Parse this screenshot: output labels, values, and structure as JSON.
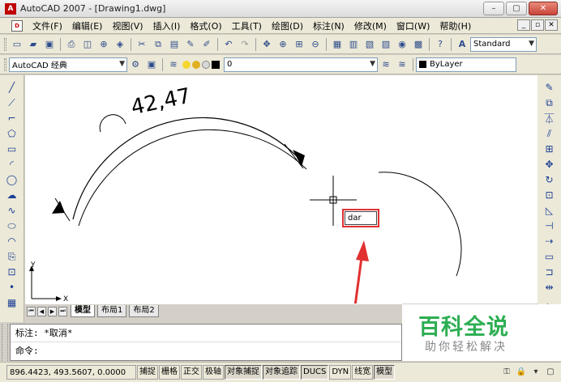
{
  "window": {
    "title": "AutoCAD 2007 - [Drawing1.dwg]",
    "min": "–",
    "max": "▢",
    "close": "✕"
  },
  "menu": [
    "文件(F)",
    "编辑(E)",
    "视图(V)",
    "插入(I)",
    "格式(O)",
    "工具(T)",
    "绘图(D)",
    "标注(N)",
    "修改(M)",
    "窗口(W)",
    "帮助(H)"
  ],
  "toolbar": {
    "text_style": "Standard",
    "workspace": "AutoCAD 经典",
    "layer": "0",
    "color": "ByLayer"
  },
  "canvas": {
    "dimension_text": "42,47",
    "dyn_input": "dar",
    "ucs_x": "X",
    "ucs_y": "Y"
  },
  "layout_tabs": [
    "模型",
    "布局1",
    "布局2"
  ],
  "command": {
    "history": "标注: *取消*",
    "prompt": "命令:"
  },
  "watermark": {
    "title": "百科全说",
    "subtitle": "助你轻松解决"
  },
  "status": {
    "coordinates": "896.4423, 493.5607, 0.0000",
    "toggles": [
      "捕捉",
      "栅格",
      "正交",
      "极轴",
      "对象捕捉",
      "对象追踪",
      "DUCS",
      "DYN",
      "线宽",
      "模型"
    ],
    "on": [
      4,
      5,
      6,
      9
    ]
  },
  "colors": {
    "accent_red": "#e23030",
    "watermark_green": "#2cae52"
  }
}
